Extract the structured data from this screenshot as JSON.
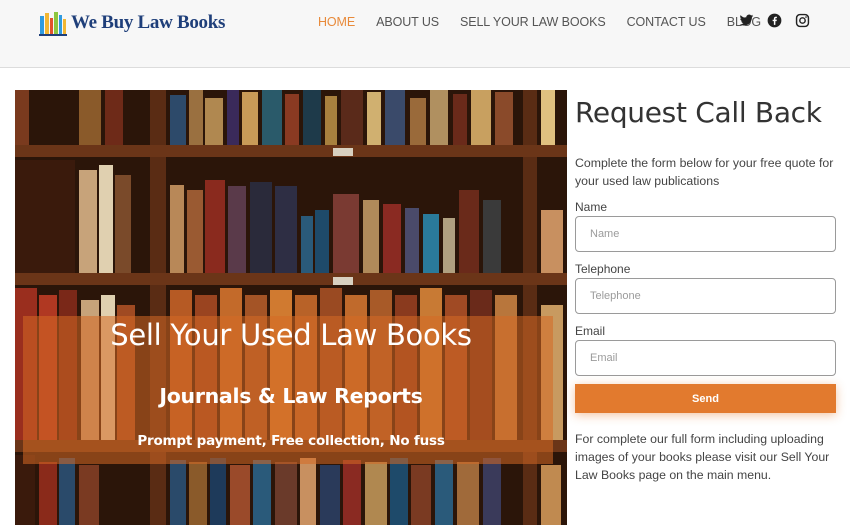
{
  "header": {
    "logo_text": "We Buy Law Books",
    "nav": [
      {
        "label": "HOME",
        "active": true
      },
      {
        "label": "ABOUT US",
        "active": false
      },
      {
        "label": "SELL YOUR LAW BOOKS",
        "active": false
      },
      {
        "label": "CONTACT US",
        "active": false
      },
      {
        "label": "BLOG",
        "active": false
      }
    ],
    "social_icons": [
      "twitter-icon",
      "facebook-icon",
      "instagram-icon"
    ]
  },
  "hero": {
    "title": "Sell Your Used Law Books",
    "subtitle": "Journals & Law Reports",
    "tagline": "Prompt payment, Free collection, No fuss"
  },
  "form": {
    "title": "Request Call Back",
    "intro": "Complete the form below for your free quote for your used law publications",
    "fields": [
      {
        "label": "Name",
        "placeholder": "Name",
        "value": ""
      },
      {
        "label": "Telephone",
        "placeholder": "Telephone",
        "value": ""
      },
      {
        "label": "Email",
        "placeholder": "Email",
        "value": ""
      }
    ],
    "send_label": "Send",
    "note": "For complete our full form including uploading images of your books please visit our Sell Your Law Books page on the main menu."
  },
  "colors": {
    "accent": "#e27a2e",
    "nav_active": "#e88a3a",
    "logo": "#1f3f7a"
  }
}
